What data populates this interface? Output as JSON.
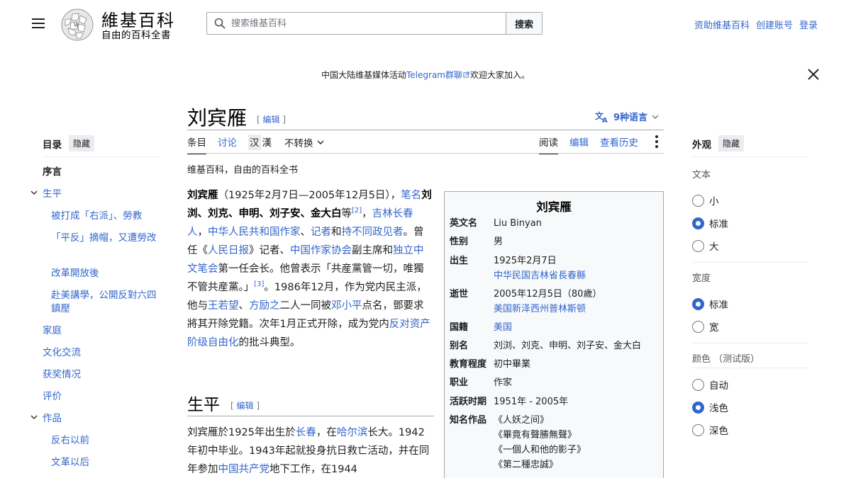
{
  "header": {
    "logo_title": "維基百科",
    "logo_tagline": "自由的百科全書",
    "search_placeholder": "搜索维基百科",
    "search_button": "搜索",
    "links": [
      "资助维基百科",
      "创建账号",
      "登录"
    ]
  },
  "banner": {
    "before": "中国大陆维基媒体活动",
    "link": "Telegram群聊",
    "after": "欢迎大家加入。"
  },
  "title": {
    "text": "刘宾雁",
    "edit": "编辑",
    "lang": "9种语言"
  },
  "tabs": {
    "article": "条目",
    "talk": "讨论",
    "variant_simplified": "汉",
    "variant_traditional": "漢",
    "convert": "不转换",
    "read": "阅读",
    "edit": "编辑",
    "history": "查看历史"
  },
  "subtitle": "维基百科，自由的百科全书",
  "toc": {
    "title": "目录",
    "hide": "隐藏",
    "items": [
      "序言",
      "生平",
      "被打成「右派」、勞教",
      "「平反」摘帽，又遭勞改",
      "改革開放後",
      "赴美講學，公開反對六四鎮壓",
      "家庭",
      "文化交流",
      "获奖情况",
      "评价",
      "作品",
      "反右以前",
      "文革以后"
    ]
  },
  "appearance": {
    "title": "外观",
    "hide": "隐藏",
    "text_label": "文本",
    "text_options": [
      "小",
      "标准",
      "大"
    ],
    "width_label": "宽度",
    "width_options": [
      "标准",
      "宽"
    ],
    "color_label": "颜色 （测试版）",
    "color_options": [
      "自动",
      "浅色",
      "深色"
    ]
  },
  "lead": {
    "name": "刘宾雁",
    "dates": "（1925年2月7日—2005年12月5日），",
    "pen": "笔名",
    "aliases": "刘浏、刘克、申明、刘子安、金大白",
    "deng": "等",
    "ref2": "[2]",
    "birthplace": "吉林长春人",
    "nat_writer": "中华人民共和国作家",
    "reporter": "记者",
    "and": "和",
    "dissident": "持不同政见者",
    "served": "。曾任《",
    "peoples_daily": "人民日报",
    "reporter2": "》记者、",
    "writers_assoc": "中国作家协会",
    "vice_chair": "副主席和",
    "indep_pen": "独立中文笔会",
    "first_pres": "第一任会长。他曾表示「共産黨管一切，唯獨不管共産黨。」",
    "ref3": "[3]",
    "part3": "。1986年12月，作为党内民主派，他与",
    "wang": "王若望",
    "comma": "、",
    "fang": "方励之",
    "part4": "二人一同被",
    "deng_xp": "邓小平",
    "part5": "点名，鄧要求將其开除党籍。次年1月正式开除，成为党内",
    "anti_bourg": "反对资产阶级自由化",
    "part6": "的批斗典型。"
  },
  "section": {
    "title": "生平",
    "edit": "编辑",
    "p1": "刘宾雁於1925年出生於",
    "changchun": "长春",
    "p2": "，在",
    "harbin": "哈尔滨",
    "p3": "长大。1942年初中毕业。1943年起就投身抗日救亡活动，并在同年参加",
    "ccp": "中国共产党",
    "p4": "地下工作，在1944"
  },
  "infobox": {
    "title": "刘宾雁",
    "rows": [
      {
        "k": "英文名",
        "v": "Liu Binyan"
      },
      {
        "k": "性别",
        "v": "男"
      },
      {
        "k": "出生",
        "v": "1925年2月7日",
        "link": "中华民国吉林省長春縣"
      },
      {
        "k": "逝世",
        "v": "2005年12月5日（80歲）",
        "link": "美国新泽西州普林斯顿"
      },
      {
        "k": "国籍",
        "link": "美国"
      },
      {
        "k": "别名",
        "v": "刘浏、刘克、申明、刘子安、金大白"
      },
      {
        "k": "教育程度",
        "v": "初中畢業"
      },
      {
        "k": "职业",
        "v": "作家"
      },
      {
        "k": "活跃时期",
        "v": "1951年 - 2005年"
      },
      {
        "k": "知名作品",
        "works": [
          "《人妖之间》",
          "《畢竟有聲勝無聲》",
          "《一個人和他的影子》",
          "《第二種忠誠》"
        ]
      }
    ]
  }
}
